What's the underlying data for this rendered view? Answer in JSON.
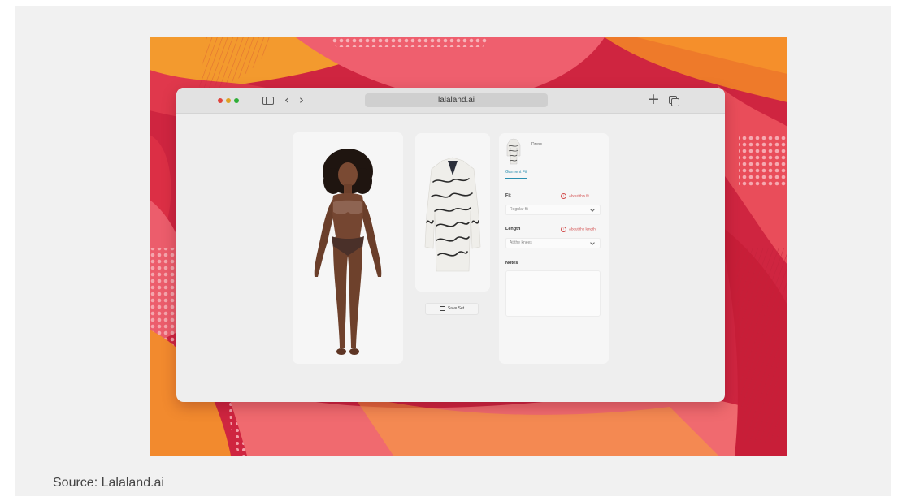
{
  "browser": {
    "url": "lalaland.ai",
    "icons": [
      "sidebar-toggle-icon",
      "chevron-left-icon",
      "chevron-right-icon",
      "plus-icon",
      "tabs-icon"
    ],
    "nav_back": "‹",
    "nav_forward": "›",
    "new_tab": "+"
  },
  "garment": {
    "type_label": "Dress",
    "save_label": "Save Set"
  },
  "settings": {
    "tab_label": "Garment Fit",
    "fit_label": "Fit",
    "fit_help": "About this fit",
    "fit_value": "Regular fit",
    "length_label": "Length",
    "length_help": "About the length",
    "length_value": "At the knees",
    "notes_label": "Notes",
    "notes_value": ""
  },
  "caption": "Source: Lalaland.ai",
  "colors": {
    "accent_tab": "#2b8fb0",
    "help_link": "#d24b4b",
    "traffic_red": "#e0443e",
    "traffic_yellow": "#dea123",
    "traffic_green": "#2fae38"
  }
}
